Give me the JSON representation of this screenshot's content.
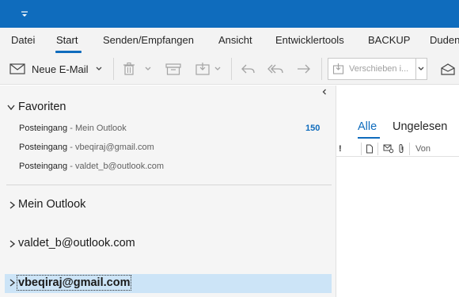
{
  "titlebar": {
    "quick_access_icon": "dropdown-customize-icon"
  },
  "ribbon": {
    "tabs": [
      {
        "label": "Datei"
      },
      {
        "label": "Start",
        "active": true
      },
      {
        "label": "Senden/Empfangen"
      },
      {
        "label": "Ansicht"
      },
      {
        "label": "Entwicklertools"
      },
      {
        "label": "BACKUP"
      },
      {
        "label": "Duden"
      }
    ]
  },
  "toolbar": {
    "new_mail_label": "Neue E-Mail",
    "move_label": "Verschieben i...",
    "icons": [
      "mail-icon",
      "delete-icon",
      "archive-icon",
      "move-to-icon",
      "reply-icon",
      "reply-all-icon",
      "forward-icon",
      "open-envelope-icon"
    ]
  },
  "folders": {
    "favorites_title": "Favoriten",
    "favorites": [
      {
        "folder": "Posteingang",
        "account": "Mein Outlook",
        "unread": "150"
      },
      {
        "folder": "Posteingang",
        "account": "vbeqiraj@gmail.com"
      },
      {
        "folder": "Posteingang",
        "account": "valdet_b@outlook.com"
      }
    ],
    "accounts": [
      {
        "label": "Mein Outlook"
      },
      {
        "label": "valdet_b@outlook.com"
      },
      {
        "label": "vbeqiraj@gmail.com",
        "selected": true
      }
    ]
  },
  "message_list": {
    "tabs": {
      "all": "Alle",
      "unread": "Ungelesen"
    },
    "columns": {
      "importance": "!",
      "from": "Von"
    }
  },
  "colors": {
    "accent": "#0f6cbd",
    "selection": "#cce4f7",
    "ribbon_bg": "#f3f3f3",
    "folder_bg": "#f5f5f5"
  }
}
